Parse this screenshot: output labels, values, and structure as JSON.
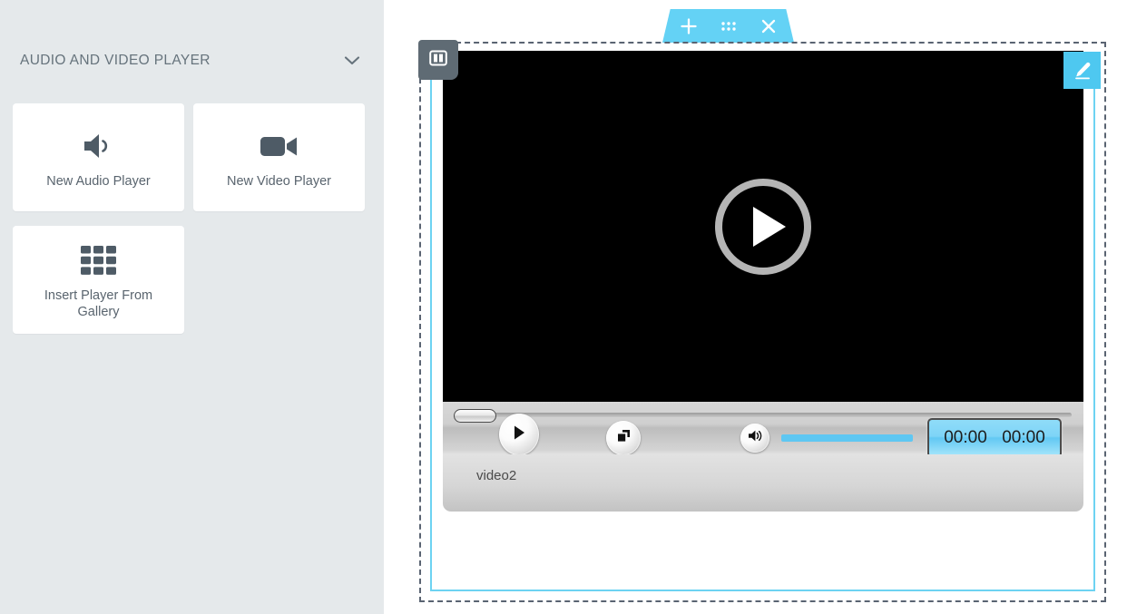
{
  "sidebar": {
    "panel_title": "AUDIO AND VIDEO PLAYER",
    "collapse_chevron_icon": "chevron-down-icon",
    "collapse_tab_icon": "chevron-left-icon",
    "cards": [
      {
        "label": "New Audio Player",
        "icon": "speaker-icon"
      },
      {
        "label": "New Video Player",
        "icon": "video-camera-icon"
      },
      {
        "label": "Insert Player From Gallery",
        "icon": "grid-icon"
      }
    ]
  },
  "toolbar": {
    "add_label": "+",
    "add_icon": "plus-icon",
    "move_icon": "grid-dots-icon",
    "close_label": "×",
    "close_icon": "close-icon"
  },
  "widget": {
    "drag_handle_icon": "pause-handle-icon",
    "edit_icon": "pencil-icon"
  },
  "player": {
    "play_overlay_icon": "play-circle-icon",
    "play_button_icon": "play-icon",
    "fullscreen_button_icon": "fullscreen-icon",
    "volume_button_icon": "volume-icon",
    "scrubber_icon": "scrubber-handle",
    "time_current": "00:00",
    "time_total": "00:00",
    "playlist_items": [
      {
        "label": "video2"
      }
    ]
  },
  "colors": {
    "accent_blue": "#64d2f5",
    "edit_blue": "#4ec8f0",
    "sidebar_bg": "#e5e9eb",
    "selection_border": "#5a6472",
    "frame_blue": "#6dd3f2",
    "volume_fill": "#5ec7f2",
    "icon_gray": "#4e5b66"
  }
}
